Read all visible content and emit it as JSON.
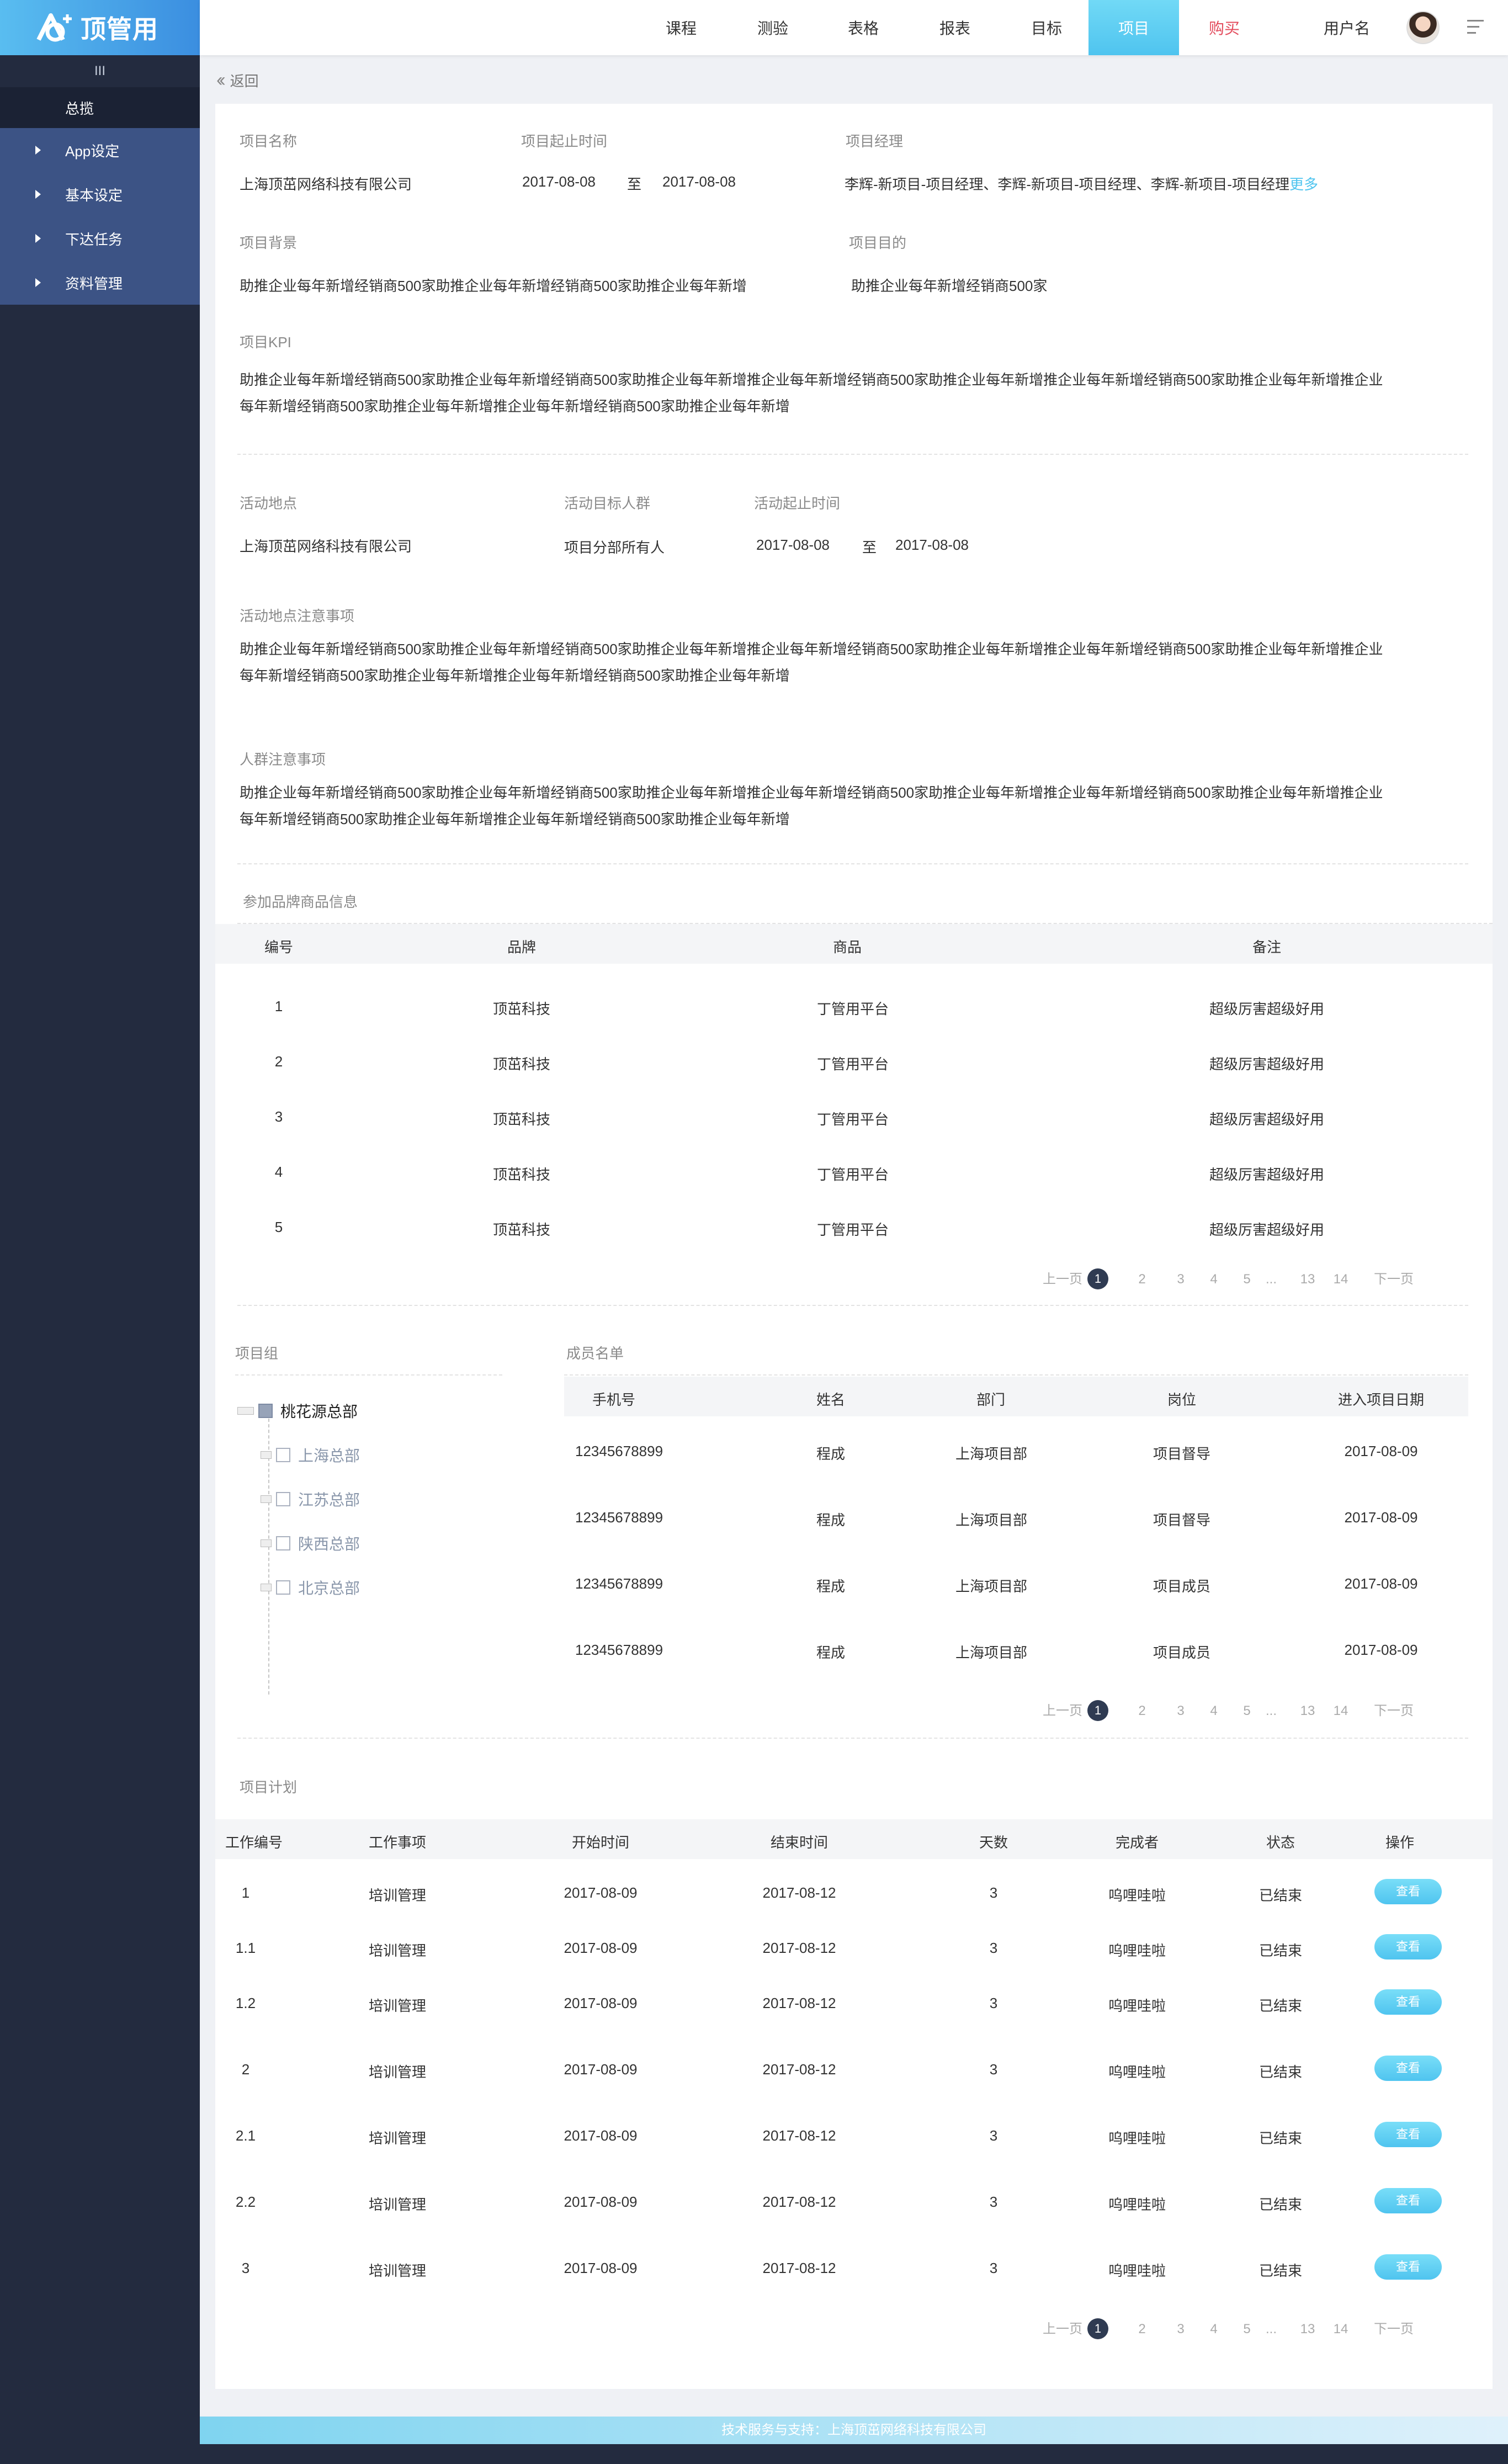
{
  "app": {
    "brand": "顶管用"
  },
  "sidebar": {
    "collapse_glyph": "III",
    "overview": "总揽",
    "items": [
      {
        "label": "App设定"
      },
      {
        "label": "基本设定"
      },
      {
        "label": "下达任务"
      },
      {
        "label": "资料管理"
      }
    ]
  },
  "topnav": {
    "items": [
      {
        "label": "课程"
      },
      {
        "label": "测验"
      },
      {
        "label": "表格"
      },
      {
        "label": "报表"
      },
      {
        "label": "目标"
      },
      {
        "label": "项目"
      },
      {
        "label": "购买"
      }
    ],
    "active": "项目",
    "username": "用户名"
  },
  "back_label": "返回",
  "project": {
    "name_label": "项目名称",
    "name": "上海顶茁网络科技有限公司",
    "period_label": "项目起止时间",
    "start": "2017-08-08",
    "to": "至",
    "end": "2017-08-08",
    "manager_label": "项目经理",
    "managers": "李辉-新项目-项目经理、李辉-新项目-项目经理、李辉-新项目-项目经理",
    "more": "更多",
    "background_label": "项目背景",
    "background": "助推企业每年新增经销商500家助推企业每年新增经销商500家助推企业每年新增",
    "goal_label": "项目目的",
    "goal": "助推企业每年新增经销商500家",
    "kpi_label": "项目KPI",
    "kpi_line1": "助推企业每年新增经销商500家助推企业每年新增经销商500家助推企业每年新增推企业每年新增经销商500家助推企业每年新增推企业每年新增经销商500家助推企业每年新增推企业",
    "kpi_line2": "每年新增经销商500家助推企业每年新增推企业每年新增经销商500家助推企业每年新增"
  },
  "activity": {
    "place_label": "活动地点",
    "place": "上海顶茁网络科技有限公司",
    "target_label": "活动目标人群",
    "target": "项目分部所有人",
    "period_label": "活动起止时间",
    "start": "2017-08-08",
    "to": "至",
    "end": "2017-08-08",
    "place_notes_label": "活动地点注意事项",
    "place_notes_line1": "助推企业每年新增经销商500家助推企业每年新增经销商500家助推企业每年新增推企业每年新增经销商500家助推企业每年新增推企业每年新增经销商500家助推企业每年新增推企业",
    "place_notes_line2": "每年新增经销商500家助推企业每年新增推企业每年新增经销商500家助推企业每年新增",
    "crowd_notes_label": "人群注意事项",
    "crowd_notes_line1": "助推企业每年新增经销商500家助推企业每年新增经销商500家助推企业每年新增推企业每年新增经销商500家助推企业每年新增推企业每年新增经销商500家助推企业每年新增推企业",
    "crowd_notes_line2": "每年新增经销商500家助推企业每年新增推企业每年新增经销商500家助推企业每年新增"
  },
  "brands": {
    "title": "参加品牌商品信息",
    "headers": [
      "编号",
      "品牌",
      "商品",
      "备注"
    ],
    "rows": [
      [
        "1",
        "顶茁科技",
        "丁管用平台",
        "超级厉害超级好用"
      ],
      [
        "2",
        "顶茁科技",
        "丁管用平台",
        "超级厉害超级好用"
      ],
      [
        "3",
        "顶茁科技",
        "丁管用平台",
        "超级厉害超级好用"
      ],
      [
        "4",
        "顶茁科技",
        "丁管用平台",
        "超级厉害超级好用"
      ],
      [
        "5",
        "顶茁科技",
        "丁管用平台",
        "超级厉害超级好用"
      ]
    ]
  },
  "pager": {
    "prev": "上一页",
    "next": "下一页",
    "pages": [
      "1",
      "2",
      "3",
      "4",
      "5",
      "...",
      "13",
      "14"
    ],
    "current": "1"
  },
  "group": {
    "title": "项目组",
    "root": "桃花源总部",
    "children": [
      "上海总部",
      "江苏总部",
      "陕西总部",
      "北京总部"
    ]
  },
  "members": {
    "title": "成员名单",
    "headers": [
      "手机号",
      "姓名",
      "部门",
      "岗位",
      "进入项目日期"
    ],
    "rows": [
      [
        "12345678899",
        "程成",
        "上海项目部",
        "项目督导",
        "2017-08-09"
      ],
      [
        "12345678899",
        "程成",
        "上海项目部",
        "项目督导",
        "2017-08-09"
      ],
      [
        "12345678899",
        "程成",
        "上海项目部",
        "项目成员",
        "2017-08-09"
      ],
      [
        "12345678899",
        "程成",
        "上海项目部",
        "项目成员",
        "2017-08-09"
      ]
    ]
  },
  "plan": {
    "title": "项目计划",
    "headers": [
      "工作编号",
      "工作事项",
      "开始时间",
      "结束时间",
      "天数",
      "完成者",
      "状态",
      "操作"
    ],
    "view_label": "查看",
    "rows": [
      [
        "1",
        "培训管理",
        "2017-08-09",
        "2017-08-12",
        "3",
        "呜哩哇啦",
        "已结束"
      ],
      [
        "1.1",
        "培训管理",
        "2017-08-09",
        "2017-08-12",
        "3",
        "呜哩哇啦",
        "已结束"
      ],
      [
        "1.2",
        "培训管理",
        "2017-08-09",
        "2017-08-12",
        "3",
        "呜哩哇啦",
        "已结束"
      ],
      [
        "2",
        "培训管理",
        "2017-08-09",
        "2017-08-12",
        "3",
        "呜哩哇啦",
        "已结束"
      ],
      [
        "2.1",
        "培训管理",
        "2017-08-09",
        "2017-08-12",
        "3",
        "呜哩哇啦",
        "已结束"
      ],
      [
        "2.2",
        "培训管理",
        "2017-08-09",
        "2017-08-12",
        "3",
        "呜哩哇啦",
        "已结束"
      ],
      [
        "3",
        "培训管理",
        "2017-08-09",
        "2017-08-12",
        "3",
        "呜哩哇啦",
        "已结束"
      ]
    ]
  },
  "footer": {
    "text": "技术服务与支持：上海顶茁网络科技有限公司"
  },
  "colors": {
    "accent": "#4fc4ef",
    "sidebar": "#232b3f",
    "menu": "#3c5385",
    "buy": "#e34b5c"
  }
}
